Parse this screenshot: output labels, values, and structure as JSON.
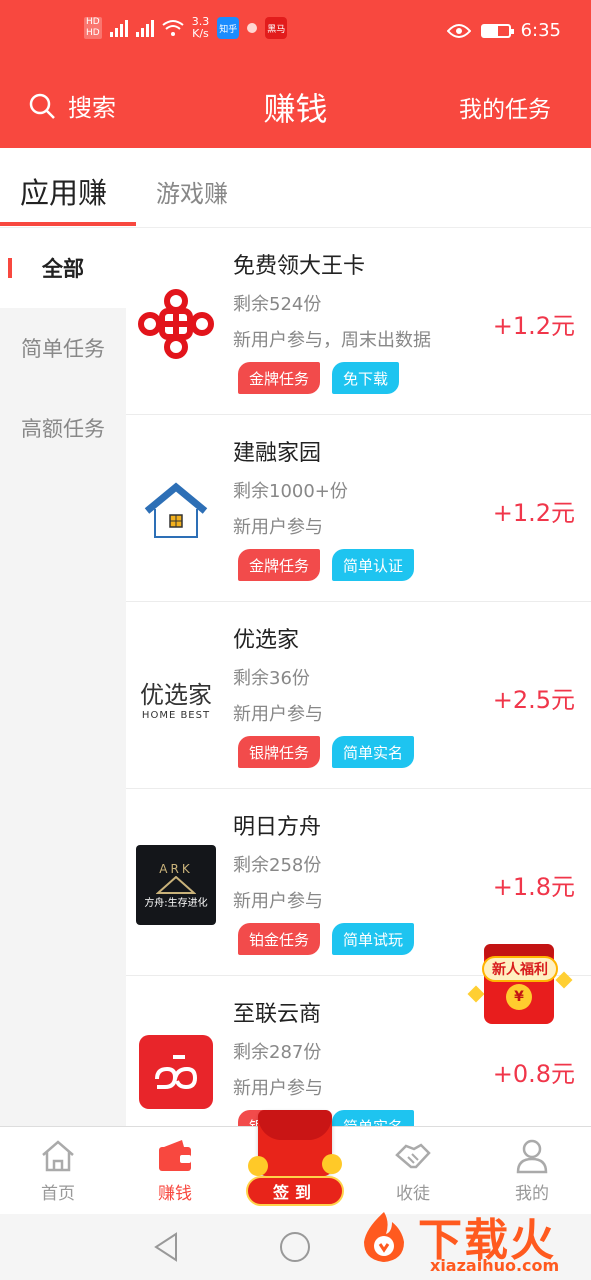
{
  "status_bar": {
    "network_speed_value": "3.3",
    "network_speed_unit": "K/s",
    "app_icon_zhihu": "知乎",
    "app_icon_red": "黑马",
    "time": "6:35"
  },
  "header": {
    "search_label": "搜索",
    "title": "赚钱",
    "my_tasks_label": "我的任务"
  },
  "tabs": [
    {
      "label": "应用赚",
      "active": true
    },
    {
      "label": "游戏赚",
      "active": false
    }
  ],
  "sidebar": {
    "items": [
      {
        "label": "全部",
        "active": true
      },
      {
        "label": "简单任务",
        "active": false
      },
      {
        "label": "高额任务",
        "active": false
      }
    ]
  },
  "tasks": [
    {
      "title": "免费领大王卡",
      "remaining": "剩余524份",
      "desc": "新用户参与，周末出数据",
      "reward": "+1.2元",
      "tags": [
        "金牌任务",
        "免下载"
      ],
      "logo": "china-unicom-logo"
    },
    {
      "title": "建融家园",
      "remaining": "剩余1000+份",
      "desc": "新用户参与",
      "reward": "+1.2元",
      "tags": [
        "金牌任务",
        "简单认证"
      ],
      "logo": "house-logo"
    },
    {
      "title": "优选家",
      "remaining": "剩余36份",
      "desc": "新用户参与",
      "reward": "+2.5元",
      "tags": [
        "银牌任务",
        "简单实名"
      ],
      "logo": "youxuanjia-logo",
      "logo_text": "优选家",
      "logo_sub": "HOME BEST"
    },
    {
      "title": "明日方舟",
      "remaining": "剩余258份",
      "desc": "新用户参与",
      "reward": "+1.8元",
      "tags": [
        "铂金任务",
        "简单试玩"
      ],
      "logo": "ark-game-logo",
      "logo_text": "方舟:生存进化",
      "logo_top": "ARK"
    },
    {
      "title": "至联云商",
      "remaining": "剩余287份",
      "desc": "新用户参与",
      "reward": "+0.8元",
      "tags": [
        "银牌任务",
        "简单实名"
      ],
      "logo": "zhilian-logo"
    }
  ],
  "bonus_badge": {
    "label": "新人福利",
    "coin": "¥"
  },
  "bottom_nav": {
    "items": [
      {
        "label": "首页",
        "icon": "home-icon",
        "active": false
      },
      {
        "label": "赚钱",
        "icon": "wallet-icon",
        "active": true
      },
      {
        "label": "收徒",
        "icon": "handshake-icon",
        "active": false
      },
      {
        "label": "我的",
        "icon": "person-icon",
        "active": false
      }
    ],
    "signin_label": "签到"
  },
  "watermark": {
    "text": "下载火",
    "url": "xiazaihuo.com"
  },
  "colors": {
    "primary": "#f8483f",
    "reward": "#f0364a",
    "tag_red": "#f24b4b",
    "tag_blue": "#1ec4f0"
  }
}
